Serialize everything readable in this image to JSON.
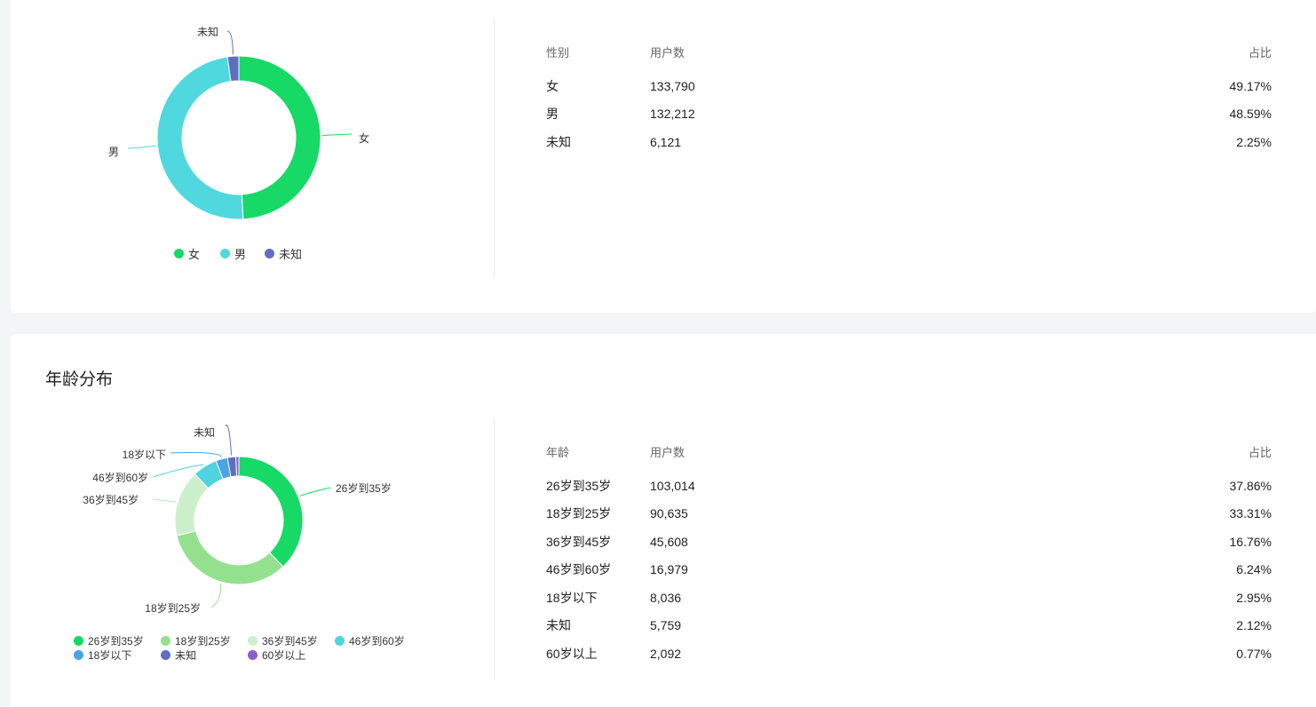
{
  "gender": {
    "chart_data": {
      "type": "pie",
      "variant": "donut",
      "categories": [
        "女",
        "男",
        "未知"
      ],
      "values": [
        133790,
        132212,
        6121
      ],
      "colors": [
        "#16d966",
        "#4fd9df",
        "#5e6fc2"
      ],
      "legend_position": "bottom"
    },
    "table": {
      "headers": [
        "性别",
        "用户数",
        "占比"
      ],
      "rows": [
        [
          "女",
          "133,790",
          "49.17%"
        ],
        [
          "男",
          "132,212",
          "48.59%"
        ],
        [
          "未知",
          "6,121",
          "2.25%"
        ]
      ]
    }
  },
  "age": {
    "title": "年龄分布",
    "chart_data": {
      "type": "pie",
      "variant": "donut",
      "categories": [
        "26岁到35岁",
        "18岁到25岁",
        "36岁到45岁",
        "46岁到60岁",
        "18岁以下",
        "未知",
        "60岁以上"
      ],
      "values": [
        103014,
        90635,
        45608,
        16979,
        8036,
        5759,
        2092
      ],
      "colors": [
        "#16d966",
        "#93e18e",
        "#cdf0cc",
        "#4fd3e0",
        "#4aa3e6",
        "#5e6fc2",
        "#8a5fc7"
      ],
      "legend_position": "bottom"
    },
    "table": {
      "headers": [
        "年龄",
        "用户数",
        "占比"
      ],
      "rows": [
        [
          "26岁到35岁",
          "103,014",
          "37.86%"
        ],
        [
          "18岁到25岁",
          "90,635",
          "33.31%"
        ],
        [
          "36岁到45岁",
          "45,608",
          "16.76%"
        ],
        [
          "46岁到60岁",
          "16,979",
          "6.24%"
        ],
        [
          "18岁以下",
          "8,036",
          "2.95%"
        ],
        [
          "未知",
          "5,759",
          "2.12%"
        ],
        [
          "60岁以上",
          "2,092",
          "0.77%"
        ]
      ]
    }
  }
}
